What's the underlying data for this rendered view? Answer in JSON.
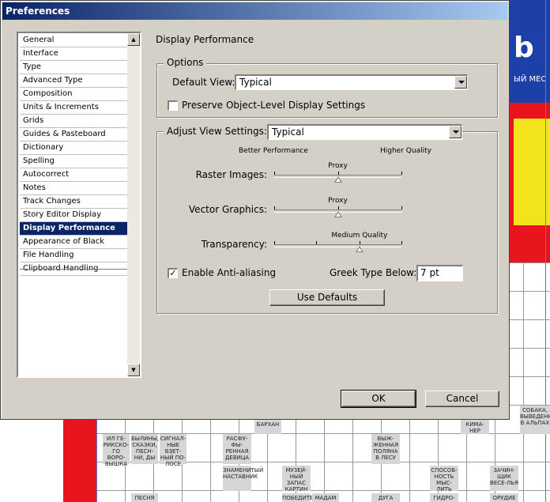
{
  "window": {
    "title": "Preferences"
  },
  "categories": [
    "General",
    "Interface",
    "Type",
    "Advanced Type",
    "Composition",
    "Units & Increments",
    "Grids",
    "Guides & Pasteboard",
    "Dictionary",
    "Spelling",
    "Autocorrect",
    "Notes",
    "Track Changes",
    "Story Editor Display",
    "Display Performance",
    "Appearance of Black",
    "File Handling",
    "Clipboard Handling"
  ],
  "selected_category": "Display Performance",
  "panel": {
    "title": "Display Performance",
    "options": {
      "legend": "Options",
      "default_view_label": "Default View:",
      "default_view_value": "Typical",
      "preserve_label": "Preserve Object-Level Display Settings",
      "preserve_checked": false
    },
    "adjust": {
      "legend": "Adjust View Settings:",
      "value": "Typical",
      "better_performance": "Better Performance",
      "higher_quality": "Higher Quality",
      "sliders": [
        {
          "label": "Raster Images:",
          "caption": "Proxy",
          "level": 0.5
        },
        {
          "label": "Vector Graphics:",
          "caption": "Proxy",
          "level": 0.5
        },
        {
          "label": "Transparency:",
          "caption": "Medium Quality",
          "level": 0.67
        }
      ],
      "anti_alias_label": "Enable Anti-aliasing",
      "anti_alias_checked": true,
      "greek_label": "Greek Type Below:",
      "greek_value": "7 pt",
      "use_defaults": "Use Defaults"
    }
  },
  "buttons": {
    "ok": "OK",
    "cancel": "Cancel"
  },
  "background": {
    "blue_text": "b",
    "blue_sub": "ЫЙ МЕС",
    "cells": [
      "БАРХАН",
      "ИЛ ГЕ-РИКСКО-ГО ВОРО-ВЫШКА",
      "БЫЛИНЫ, СКАЗКИ, ПЕСН-НИ, ДЫ",
      "СИГНАЛ-НЫЕ ВЗЕТ-НЫЙ ПО-ЛОСЕ",
      "РАСФУ-ФЫ-РЕННАЯ ДЕВИЦА",
      "ЗНАМЕНИТЫЙ НАСТАВНИК",
      "МУЗЕЙ-НЫЙ ЗАПАС КАРТИН",
      "ВЫЖ-ЖЕННАЯ ПОЛЯНА В ЛЕСУ",
      "СПОСОБ-НОСТЬ МЫС-ЛИТЬ",
      "ЗАЧИН-ЩИК ВЕСЕ-ЛЬЯ",
      "КИМА-НЕР",
      "СОБАКА, ВЫВЕДЕННАЯ В АЛЬПАХ",
      "ПЕСНЯ",
      "ПОБЕДИТЕЛЬ",
      "МАДАМ",
      "ДУГА",
      "ГИДРО-",
      "ОРУДИЕ"
    ]
  }
}
